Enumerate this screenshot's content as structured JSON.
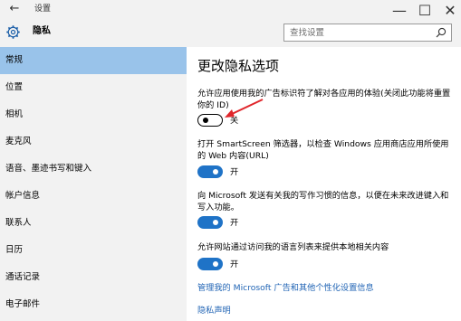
{
  "window": {
    "title": "设置",
    "back_icon": "arrow-left-icon",
    "controls": {
      "minimize": "—",
      "maximize": "☐",
      "close": "✕"
    }
  },
  "header": {
    "section_title": "隐私",
    "icon": "gear-icon"
  },
  "search": {
    "placeholder": "查找设置"
  },
  "sidebar": {
    "items": [
      {
        "label": "常规",
        "active": true
      },
      {
        "label": "位置"
      },
      {
        "label": "相机"
      },
      {
        "label": "麦克风"
      },
      {
        "label": "语音、墨迹书写和键入"
      },
      {
        "label": "帐户信息"
      },
      {
        "label": "联系人"
      },
      {
        "label": "日历"
      },
      {
        "label": "通话记录"
      },
      {
        "label": "电子邮件"
      }
    ]
  },
  "main": {
    "heading": "更改隐私选项",
    "options": [
      {
        "description": "允许应用使用我的广告标识符了解对各应用的体验(关闭此功能将重置你的 ID)",
        "state_label": "关",
        "on": false
      },
      {
        "description": "打开 SmartScreen 筛选器，以检查 Windows 应用商店应用所使用的 Web 内容(URL)",
        "state_label": "开",
        "on": true
      },
      {
        "description": "向 Microsoft 发送有关我的写作习惯的信息，以便在未来改进键入和写入功能。",
        "state_label": "开",
        "on": true
      },
      {
        "description": "允许网站通过访问我的语言列表来提供本地相关内容",
        "state_label": "开",
        "on": true
      }
    ],
    "links": [
      "管理我的 Microsoft 广告和其他个性化设置信息",
      "隐私声明"
    ]
  },
  "colors": {
    "accent": "#1f73c7",
    "active_nav": "#99c3ea",
    "link": "#1f63b4",
    "annotation": "#e0262b"
  }
}
